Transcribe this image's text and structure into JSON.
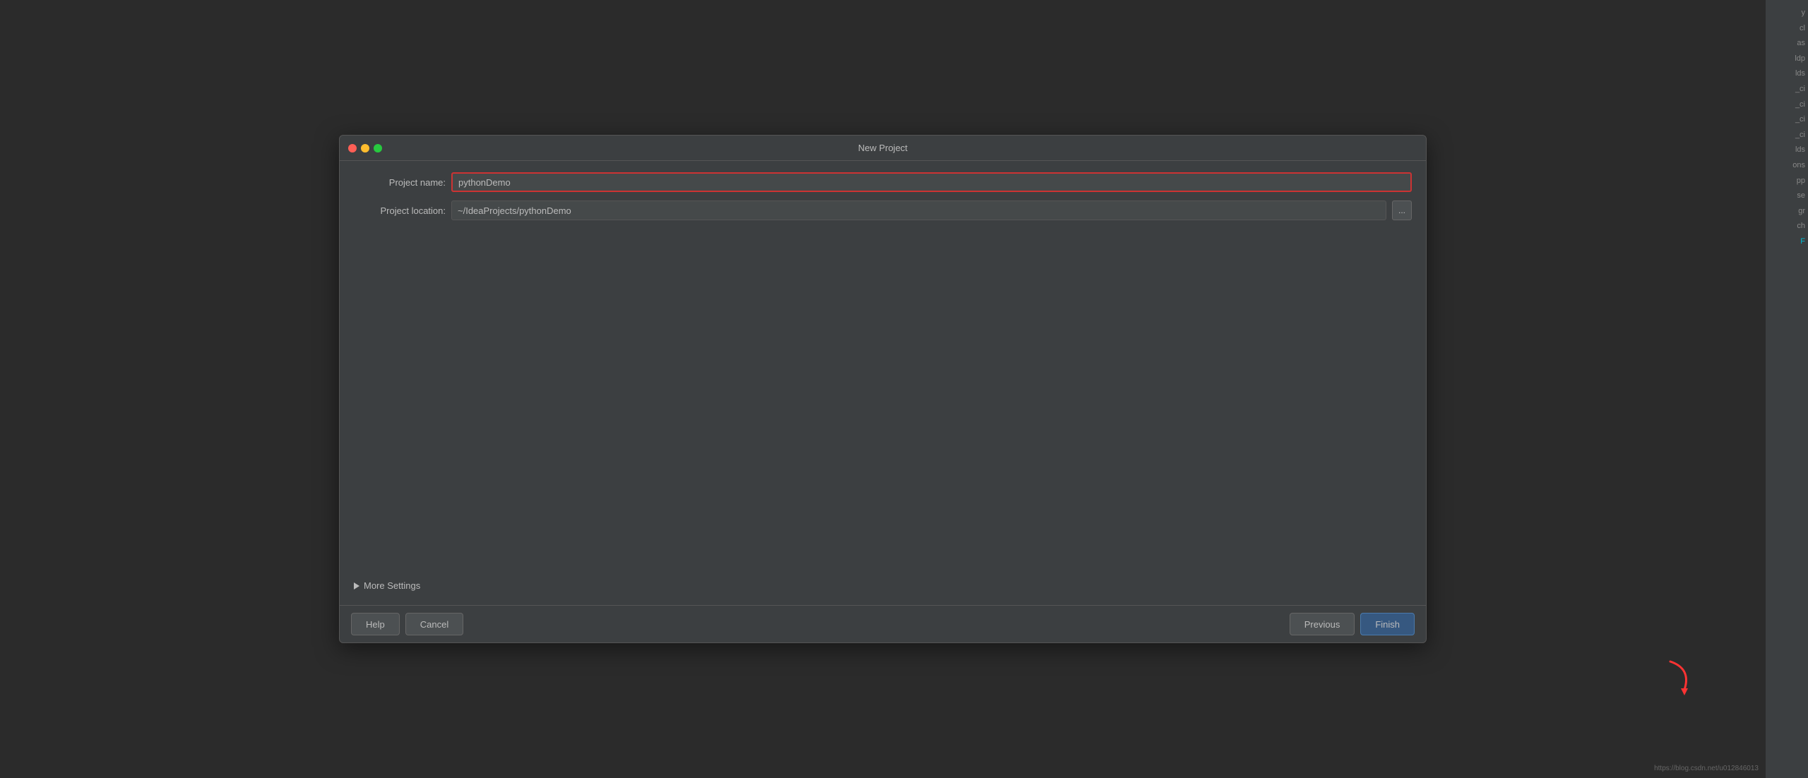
{
  "window": {
    "title": "New Project"
  },
  "dialog": {
    "title": "New Project",
    "project_name_label": "Project name:",
    "project_name_value": "pythonDemo",
    "project_location_label": "Project location:",
    "project_location_value": "~/IdeaProjects/pythonDemo",
    "browse_button": "...",
    "more_settings_label": "More Settings",
    "help_button": "Help",
    "cancel_button": "Cancel",
    "previous_button": "Previous",
    "finish_button": "Finish"
  },
  "sidebar": {
    "items": [
      {
        "text": "y",
        "teal": false
      },
      {
        "text": "cl",
        "teal": false
      },
      {
        "text": "as",
        "teal": false
      },
      {
        "text": "ldp",
        "teal": false
      },
      {
        "text": "lds",
        "teal": false
      },
      {
        "text": "_ci",
        "teal": false
      },
      {
        "text": "_ci",
        "teal": false
      },
      {
        "text": "_ci",
        "teal": false
      },
      {
        "text": "_ci",
        "teal": false
      },
      {
        "text": "lds",
        "teal": false
      },
      {
        "text": "ons",
        "teal": false
      },
      {
        "text": "pp",
        "teal": false
      },
      {
        "text": "se",
        "teal": false
      },
      {
        "text": "gr",
        "teal": false
      },
      {
        "text": "ch",
        "teal": false
      },
      {
        "text": "F",
        "teal": true
      }
    ]
  },
  "url_bar": {
    "text": "https://blog.csdn.net/u012846013"
  }
}
